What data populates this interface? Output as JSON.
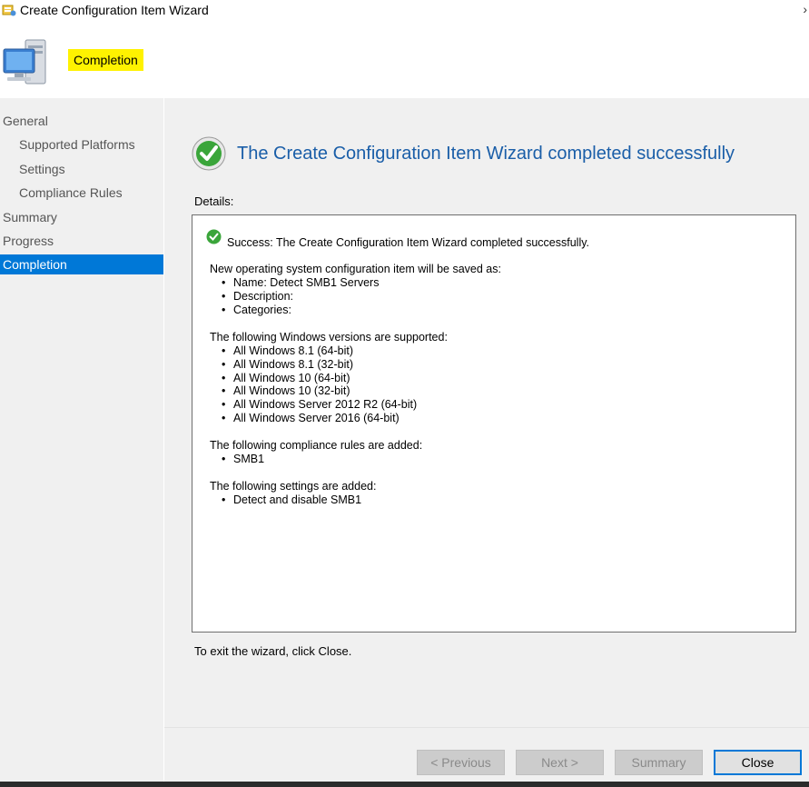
{
  "window": {
    "title": "Create Configuration Item Wizard",
    "close_glyph": "›"
  },
  "header": {
    "page_heading": "Completion",
    "highlight_color": "#fff200",
    "icon": "computer-icon"
  },
  "nav": {
    "items": [
      {
        "label": "General"
      },
      {
        "label": "Supported Platforms"
      },
      {
        "label": "Settings"
      },
      {
        "label": "Compliance Rules"
      },
      {
        "label": "Summary"
      },
      {
        "label": "Progress"
      },
      {
        "label": "Completion"
      }
    ],
    "active_color": "#0078d7"
  },
  "main": {
    "success_title": "The Create Configuration Item Wizard completed successfully",
    "details_label": "Details:",
    "details": {
      "success_line": "Success: The Create Configuration Item Wizard completed successfully.",
      "saved_as_header": "New operating system configuration item will be saved as:",
      "saved_as_items": [
        "Name: Detect SMB1 Servers",
        "Description:",
        "Categories:"
      ],
      "versions_header": "The following Windows versions are supported:",
      "versions": [
        "All Windows 8.1 (64-bit)",
        "All Windows 8.1 (32-bit)",
        "All Windows 10 (64-bit)",
        "All Windows 10 (32-bit)",
        "All Windows Server 2012 R2 (64-bit)",
        "All Windows Server 2016 (64-bit)"
      ],
      "rules_header": "The following compliance rules are added:",
      "rules": [
        "SMB1"
      ],
      "settings_header": "The following settings are added:",
      "settings": [
        "Detect and disable SMB1"
      ]
    },
    "exit_text": "To exit the wizard, click Close."
  },
  "buttons": {
    "previous": "< Previous",
    "next": "Next >",
    "summary": "Summary",
    "close": "Close"
  },
  "colors": {
    "accent": "#0078d7",
    "title_text": "#1a5ea8",
    "success_green": "#3aa53a"
  }
}
